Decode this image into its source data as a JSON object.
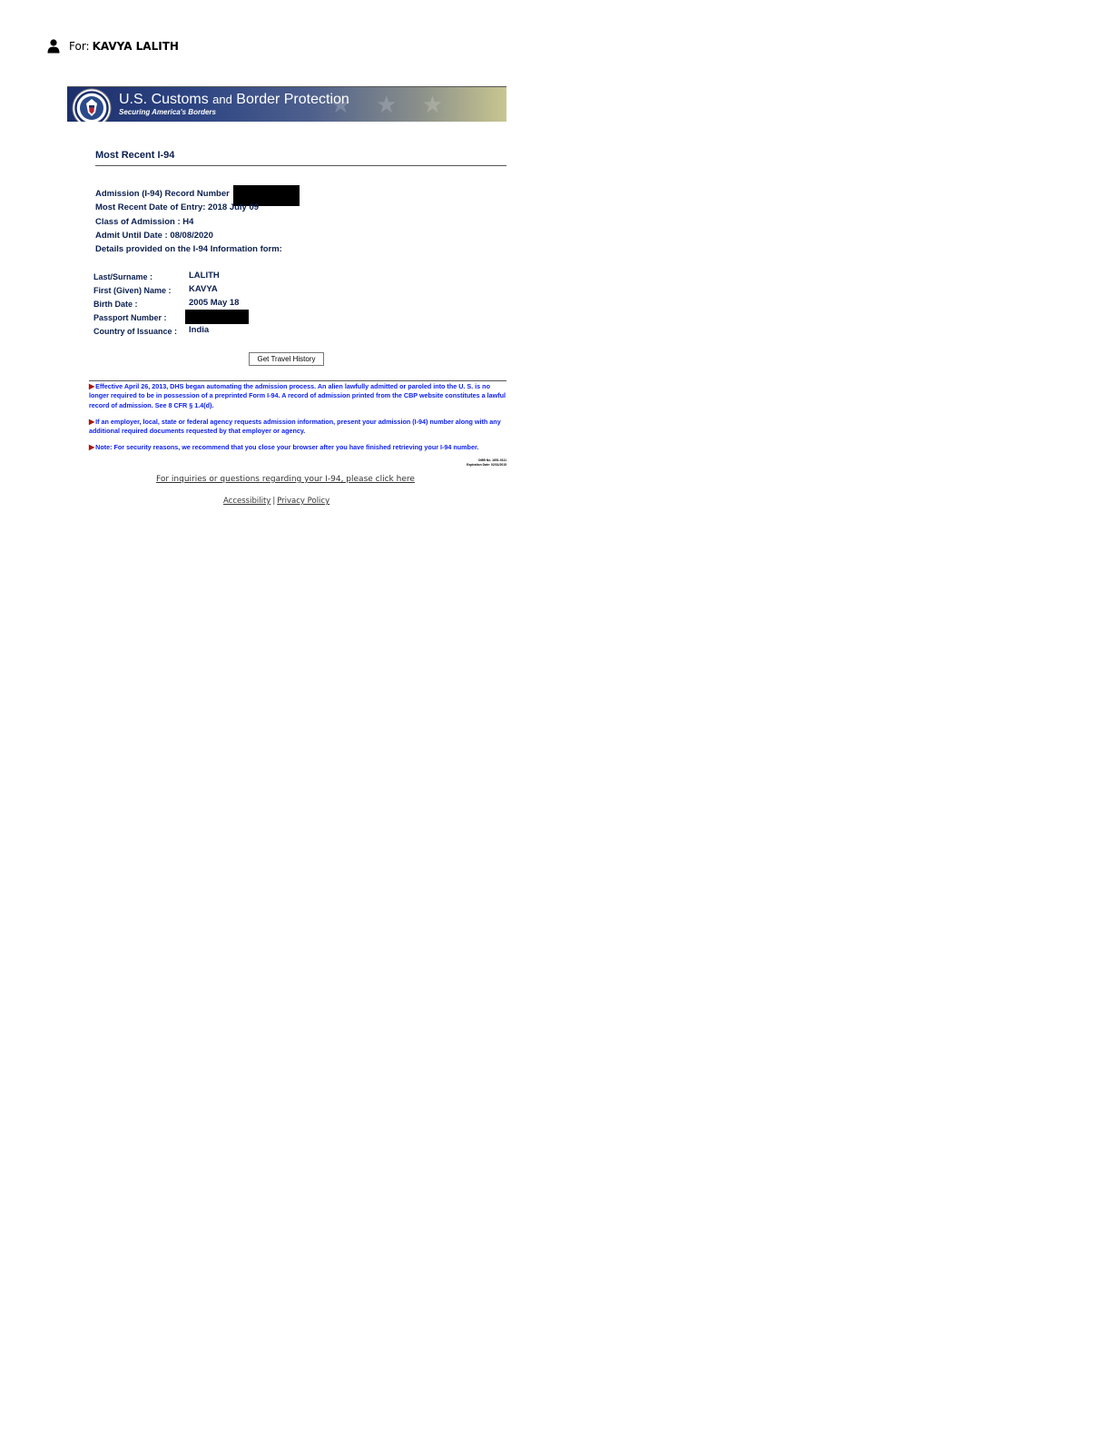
{
  "header": {
    "for_label": "For:",
    "for_name": "KAVYA LALITH",
    "user_icon": "user-icon"
  },
  "banner": {
    "title_part1": "U.S. Customs ",
    "title_part2": "and",
    "title_part3": " Border Protection",
    "subtitle": "Securing America's Borders",
    "seal_icon": "dhs-seal-icon",
    "colors": {
      "dark": "#1c2f6b",
      "light": "#c8c690"
    }
  },
  "i94": {
    "section_title": "Most Recent I-94",
    "record_number_label": "Admission (I-94) Record Number",
    "entry_date_label": "Most Recent Date of Entry: 2018 July 09",
    "class_label": "Class of Admission : H4",
    "admit_until_label": "Admit Until Date : 08/08/2020",
    "details_heading": "Details provided on the I-94 Information form:"
  },
  "details": {
    "last_name_label": "Last/Surname :",
    "last_name_value": "LALITH",
    "first_name_label": "First (Given) Name :",
    "first_name_value": "KAVYA",
    "birth_date_label": "Birth Date :",
    "birth_date_value": "2005 May 18",
    "passport_label": "Passport Number :",
    "country_label": "Country of Issuance :",
    "country_value": "India"
  },
  "actions": {
    "travel_history_button": "Get Travel History"
  },
  "notes": {
    "note1": "Effective April 26, 2013, DHS began automating the admission process. An alien lawfully admitted or paroled into the U. S. is no longer required to be in possession of a preprinted Form I-94. A record of admission printed from the CBP website constitutes a lawful record of admission.  See 8 CFR § 1.4(d).",
    "note2": "If an employer, local, state or federal agency requests admission information, present your admission (I-94) number along with any additional required documents requested by that employer or agency.",
    "note3": "Note: For security reasons, we recommend that you close your browser after you have finished retrieving your I-94 number.",
    "omb_number": "OMB No. 1651-0111",
    "expiration": "Expiration Date: 02/31/2015",
    "note_color": "#0a1ef0",
    "arrow_color": "#a8180f"
  },
  "footer": {
    "inquiry_link": "For inquiries or questions regarding your I-94, please click here",
    "accessibility_link": "Accessibility",
    "separator": "|",
    "privacy_link": "Privacy Policy"
  }
}
